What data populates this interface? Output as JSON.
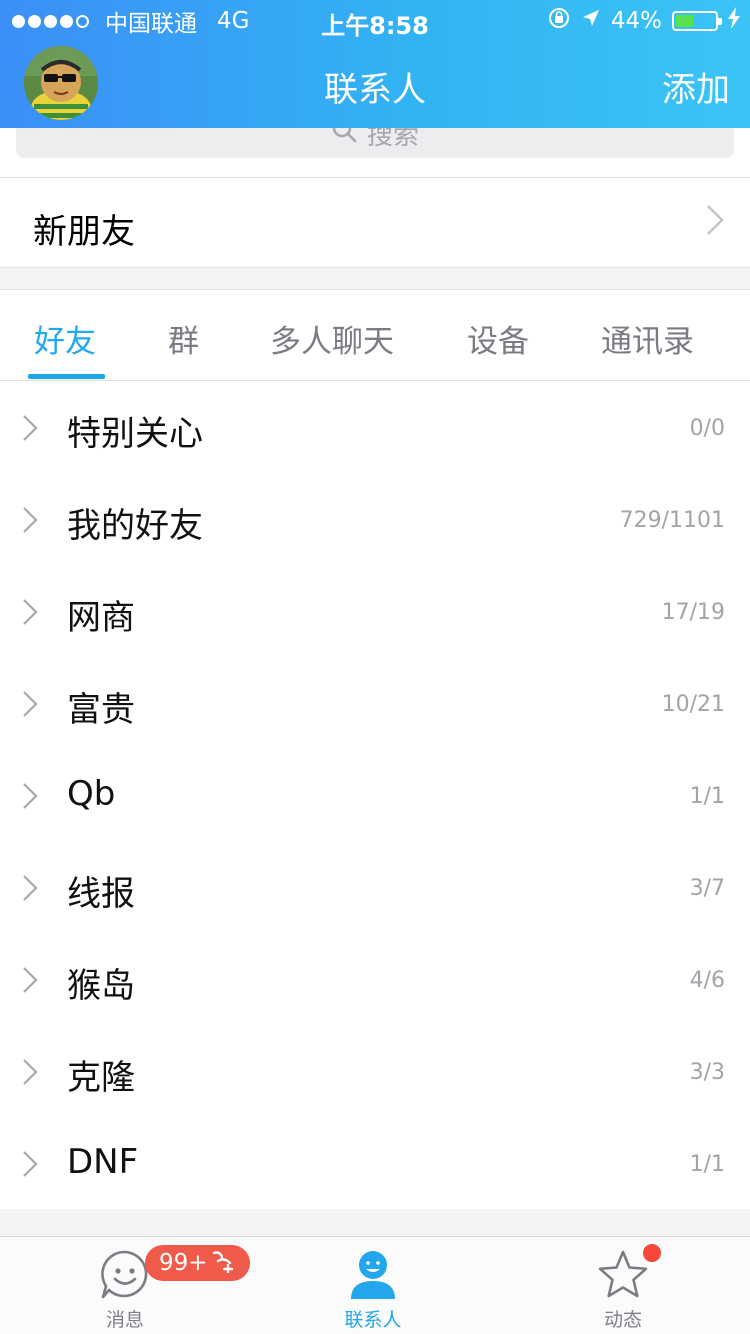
{
  "status_bar": {
    "carrier": "中国联通",
    "network": "4G",
    "time": "上午8:58",
    "battery_percent": "44%",
    "battery_level": 0.44
  },
  "nav": {
    "title": "联系人",
    "add_label": "添加"
  },
  "search": {
    "placeholder": "搜索"
  },
  "new_friends": {
    "label": "新朋友"
  },
  "tabs": [
    {
      "label": "好友",
      "active": true
    },
    {
      "label": "群",
      "active": false
    },
    {
      "label": "多人聊天",
      "active": false
    },
    {
      "label": "设备",
      "active": false
    },
    {
      "label": "通讯录",
      "active": false
    }
  ],
  "groups": [
    {
      "name": "特别关心",
      "count": "0/0"
    },
    {
      "name": "我的好友",
      "count": "729/1101"
    },
    {
      "name": "网商",
      "count": "17/19"
    },
    {
      "name": "富贵",
      "count": "10/21"
    },
    {
      "name": "Qb",
      "count": "1/1"
    },
    {
      "name": "线报",
      "count": "3/7"
    },
    {
      "name": "猴岛",
      "count": "4/6"
    },
    {
      "name": "克隆",
      "count": "3/3"
    },
    {
      "name": "DNF",
      "count": "1/1"
    }
  ],
  "tabbar": {
    "messages": {
      "label": "消息",
      "badge": "99+",
      "icon": "smiley-chat-icon"
    },
    "contacts": {
      "label": "联系人",
      "icon": "person-icon"
    },
    "moments": {
      "label": "动态",
      "icon": "star-icon"
    }
  },
  "colors": {
    "accent": "#22a8ef",
    "badge": "#f05a4a",
    "header_start": "#3b8ff7",
    "header_end": "#3ac4f5"
  }
}
